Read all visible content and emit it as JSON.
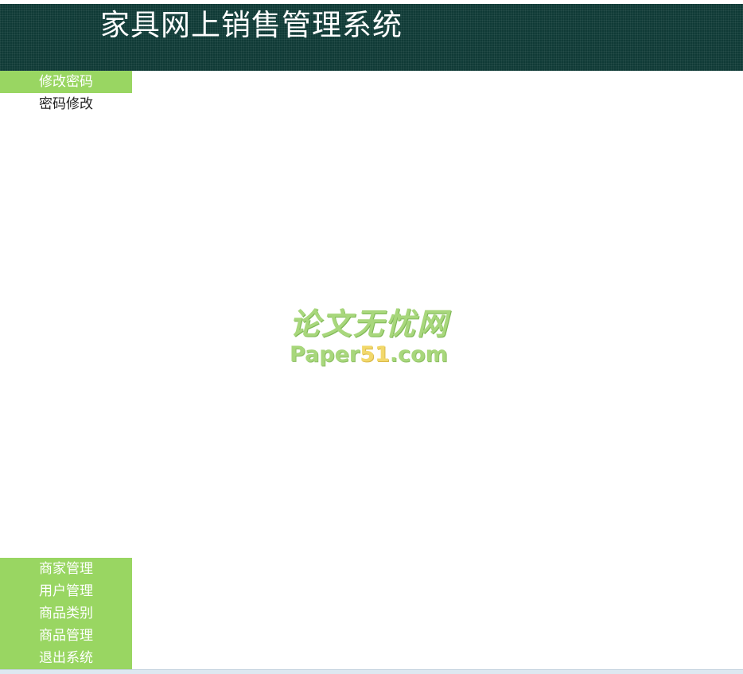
{
  "header": {
    "title": "家具网上销售管理系统"
  },
  "sidebar": {
    "top_section": {
      "label": "修改密码",
      "items": [
        {
          "label": "密码修改"
        }
      ]
    },
    "bottom_sections": [
      {
        "label": "商家管理"
      },
      {
        "label": "用户管理"
      },
      {
        "label": "商品类别"
      },
      {
        "label": "商品管理"
      },
      {
        "label": "退出系统"
      }
    ]
  },
  "watermark": {
    "cn_text": "论文无忧网",
    "en_prefix": "Paper",
    "en_accent": "51",
    "en_suffix": ".com"
  },
  "colors": {
    "header_bg": "#0f3a36",
    "menu_green": "#99d662",
    "watermark_green": "#a8d77c",
    "watermark_yellow": "#f2d86b"
  }
}
